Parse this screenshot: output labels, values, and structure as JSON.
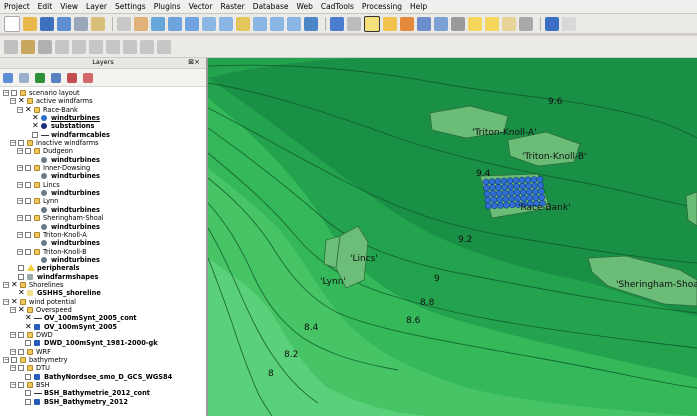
{
  "menu": [
    "Project",
    "Edit",
    "View",
    "Layer",
    "Settings",
    "Plugins",
    "Vector",
    "Raster",
    "Database",
    "Web",
    "CadTools",
    "Processing",
    "Help"
  ],
  "layers_panel": {
    "title": "Layers",
    "tree": [
      {
        "label": "scenario layout",
        "indent": 0,
        "state": "box"
      },
      {
        "label": "active windfarms",
        "indent": 1,
        "state": "x"
      },
      {
        "label": "Race-Bank",
        "indent": 2,
        "state": "x"
      },
      {
        "label": "windturbines",
        "indent": 3,
        "state": "x",
        "sym": "blue-dot",
        "bold": true,
        "underline": true
      },
      {
        "label": "substations",
        "indent": 3,
        "state": "x",
        "sym": "navy-dot",
        "bold": true
      },
      {
        "label": "windfarmcables",
        "indent": 3,
        "state": "box",
        "sym": "line",
        "bold": true
      },
      {
        "label": "inactive windfarms",
        "indent": 1,
        "state": "box"
      },
      {
        "label": "Dudgeon",
        "indent": 2,
        "state": "box"
      },
      {
        "label": "windturbines",
        "indent": 3,
        "state": "none",
        "sym": "grey-dot",
        "bold": true
      },
      {
        "label": "Inner-Dowsing",
        "indent": 2,
        "state": "box"
      },
      {
        "label": "windturbines",
        "indent": 3,
        "state": "none",
        "sym": "grey-dot",
        "bold": true
      },
      {
        "label": "Lincs",
        "indent": 2,
        "state": "box"
      },
      {
        "label": "windturbines",
        "indent": 3,
        "state": "none",
        "sym": "grey-dot",
        "bold": true
      },
      {
        "label": "Lynn",
        "indent": 2,
        "state": "box"
      },
      {
        "label": "windturbines",
        "indent": 3,
        "state": "none",
        "sym": "grey-dot",
        "bold": true
      },
      {
        "label": "Sheringham-Shoal",
        "indent": 2,
        "state": "box"
      },
      {
        "label": "windturbines",
        "indent": 3,
        "state": "none",
        "sym": "grey-dot",
        "bold": true
      },
      {
        "label": "Triton-Knoll-A",
        "indent": 2,
        "state": "box"
      },
      {
        "label": "windturbines",
        "indent": 3,
        "state": "none",
        "sym": "grey-dot",
        "bold": true
      },
      {
        "label": "Triton-Knoll-B",
        "indent": 2,
        "state": "box"
      },
      {
        "label": "windturbines",
        "indent": 3,
        "state": "none",
        "sym": "grey-dot",
        "bold": true
      },
      {
        "label": "peripherals",
        "indent": 1,
        "state": "box",
        "sym": "yellow-tri",
        "bold": true
      },
      {
        "label": "windfarmshapes",
        "indent": 1,
        "state": "box",
        "sym": "grey-sq",
        "bold": true
      },
      {
        "label": "Shorelines",
        "indent": 0,
        "state": "x"
      },
      {
        "label": "GSHHS_shoreline",
        "indent": 1,
        "state": "x",
        "sym": "yellow-sq",
        "bold": true
      },
      {
        "label": "wind potential",
        "indent": 0,
        "state": "x"
      },
      {
        "label": "Overspeed",
        "indent": 1,
        "state": "x"
      },
      {
        "label": "OV_100mSynt_2005_cont",
        "indent": 2,
        "state": "x",
        "sym": "line",
        "bold": true
      },
      {
        "label": "OV_100mSynt_2005",
        "indent": 2,
        "state": "x",
        "sym": "raster",
        "bold": true
      },
      {
        "label": "DWD",
        "indent": 1,
        "state": "box"
      },
      {
        "label": "DWD_100mSynt_1981-2000-gk",
        "indent": 2,
        "state": "box",
        "sym": "raster",
        "bold": true
      },
      {
        "label": "WRF",
        "indent": 1,
        "state": "box"
      },
      {
        "label": "bathymetry",
        "indent": 0,
        "state": "box"
      },
      {
        "label": "DTU",
        "indent": 1,
        "state": "box"
      },
      {
        "label": "BathyNordsee_smo_D_GCS_WGS84",
        "indent": 2,
        "state": "box",
        "sym": "raster",
        "bold": true
      },
      {
        "label": "BSH",
        "indent": 1,
        "state": "box"
      },
      {
        "label": "BSH_Bathymetrie_2012_cont",
        "indent": 2,
        "state": "box",
        "sym": "line",
        "bold": true
      },
      {
        "label": "BSH_Bathymetry_2012",
        "indent": 2,
        "state": "box",
        "sym": "raster",
        "bold": true
      }
    ]
  },
  "map": {
    "contour_labels": [
      "9.6",
      "9.4",
      "9.2",
      "9",
      "8.8",
      "8.6",
      "8.4",
      "8.2",
      "8"
    ],
    "windfarm_labels": [
      "'Triton-Knoll-A'",
      "'Triton-Knoll-B'",
      "'Race-Bank'",
      "'Lincs'",
      "'Lynn'",
      "'Sheringham-Shoal'"
    ]
  },
  "colors": {
    "dark_sea": "#1a8f46",
    "mid_sea": "#24a34f",
    "light_sea": "#35b85a",
    "shore": "#46c466",
    "turbine": "#2f6fd0"
  }
}
